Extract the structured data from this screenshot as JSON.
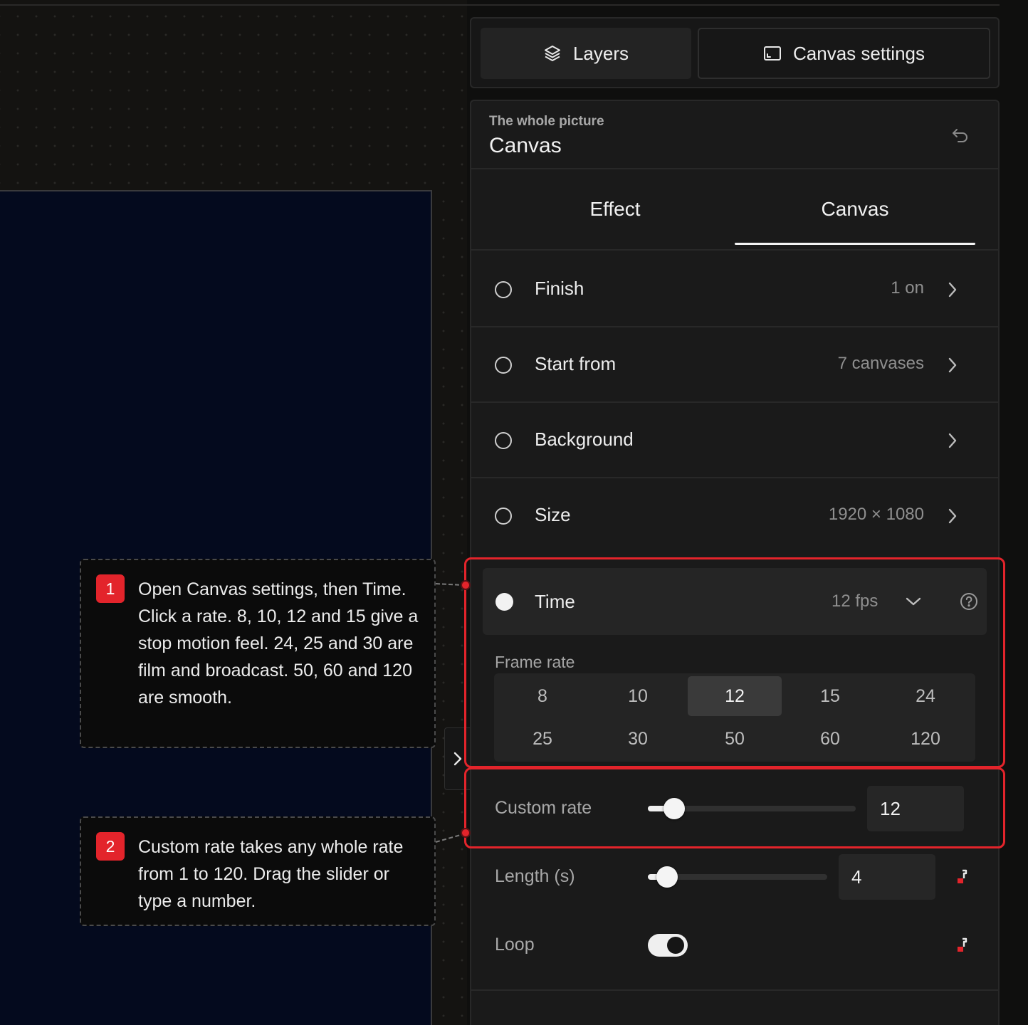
{
  "panel_tabs": {
    "layers": "Layers",
    "canvas_settings": "Canvas settings"
  },
  "header": {
    "kicker": "The whole picture",
    "title": "Canvas"
  },
  "subtabs": {
    "effect": "Effect",
    "canvas": "Canvas",
    "active": "Canvas"
  },
  "settings_rows": [
    {
      "label": "Finish",
      "value": "1 on"
    },
    {
      "label": "Start from",
      "value": "7 canvases"
    },
    {
      "label": "Background",
      "value": ""
    },
    {
      "label": "Size",
      "value": "1920 × 1080"
    }
  ],
  "time": {
    "label": "Time",
    "value": "12 fps",
    "frame_rate_label": "Frame rate",
    "options": [
      "8",
      "10",
      "12",
      "15",
      "24",
      "25",
      "30",
      "50",
      "60",
      "120"
    ],
    "selected": "12"
  },
  "custom_rate": {
    "label": "Custom rate",
    "value": "12",
    "min": 1,
    "max": 120
  },
  "length": {
    "label": "Length (s)",
    "value": "4",
    "slider_fraction": 0.1
  },
  "loop": {
    "label": "Loop",
    "on": true
  },
  "callouts": [
    {
      "step": "1",
      "text": "Open Canvas settings, then Time. Click a rate. 8, 10, 12 and 15 give a stop motion feel. 24, 25 and 30 are film and broadcast. 50, 60 and 120 are smooth."
    },
    {
      "step": "2",
      "text": "Custom rate takes any whole rate from 1 to 120. Drag the slider or type a number."
    }
  ],
  "colors": {
    "accent_red": "#e3242b",
    "panel_bg": "#1a1a1a",
    "canvas_bg": "#040a1e"
  },
  "icons": {
    "layers": "layers-icon",
    "canvas_settings": "frame-icon",
    "undo": "undo-icon",
    "chevron_right": "chevron-right-icon",
    "chevron_down": "chevron-down-icon",
    "help": "help-circle-icon",
    "keyframe": "keyframe-icon",
    "collapse": "chevron-right-icon"
  }
}
